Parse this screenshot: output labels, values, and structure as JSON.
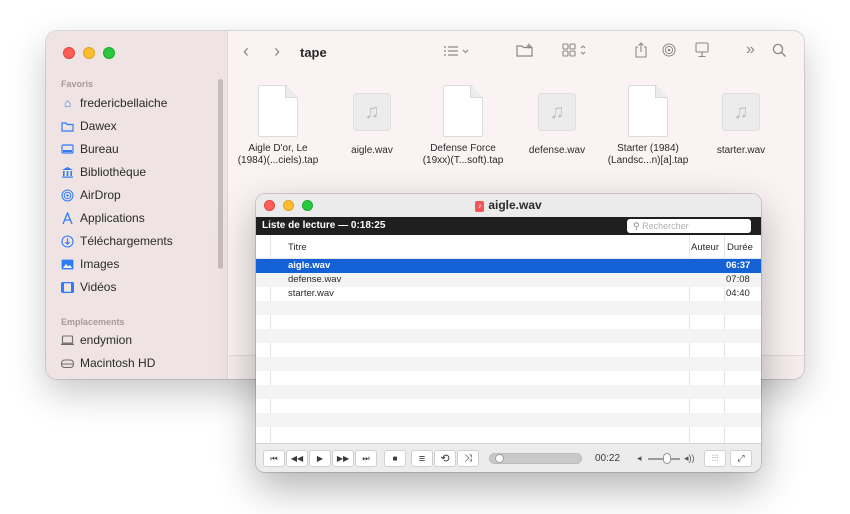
{
  "finder": {
    "location": "tape",
    "sidebar": {
      "favorites_label": "Favoris",
      "favorites": [
        {
          "label": "fredericbellaiche",
          "icon": "home-icon"
        },
        {
          "label": "Dawex",
          "icon": "folder-icon"
        },
        {
          "label": "Bureau",
          "icon": "desktop-icon"
        },
        {
          "label": "Bibliothèque",
          "icon": "library-icon"
        },
        {
          "label": "AirDrop",
          "icon": "airdrop-icon"
        },
        {
          "label": "Applications",
          "icon": "applications-icon"
        },
        {
          "label": "Téléchargements",
          "icon": "downloads-icon"
        },
        {
          "label": "Images",
          "icon": "images-icon"
        },
        {
          "label": "Vidéos",
          "icon": "videos-icon"
        }
      ],
      "locations_label": "Emplacements",
      "locations": [
        {
          "label": "endymion",
          "icon": "computer-icon"
        },
        {
          "label": "Macintosh HD",
          "icon": "disk-icon"
        }
      ]
    },
    "files": [
      {
        "name_line1": "Aigle D'or, Le",
        "name_line2": "(1984)(...ciels).tap",
        "kind": "document"
      },
      {
        "name_line1": "aigle.wav",
        "name_line2": "",
        "kind": "audio"
      },
      {
        "name_line1": "Defense Force",
        "name_line2": "(19xx)(T...soft).tap",
        "kind": "document"
      },
      {
        "name_line1": "defense.wav",
        "name_line2": "",
        "kind": "audio"
      },
      {
        "name_line1": "Starter (1984)",
        "name_line2": "(Landsc...n)[a].tap",
        "kind": "document"
      },
      {
        "name_line1": "starter.wav",
        "name_line2": "",
        "kind": "audio"
      }
    ]
  },
  "vlc": {
    "title": "aigle.wav",
    "playlist_label": "Liste de lecture — 0:18:25",
    "search_placeholder": "Rechercher",
    "columns": {
      "title": "Titre",
      "author": "Auteur",
      "duration": "Durée"
    },
    "tracks": [
      {
        "title": "aigle.wav",
        "duration": "06:37",
        "selected": true
      },
      {
        "title": "defense.wav",
        "duration": "07:08",
        "selected": false
      },
      {
        "title": "starter.wav",
        "duration": "04:40",
        "selected": false
      }
    ],
    "elapsed": "00:22",
    "progress_fraction": 0.05,
    "volume_fraction": 0.6
  },
  "colors": {
    "selection": "#1461d6",
    "sidebar_accent": "#2f7df6",
    "close": "#fe5f57",
    "minimize": "#febc2e",
    "zoom": "#28c840"
  }
}
